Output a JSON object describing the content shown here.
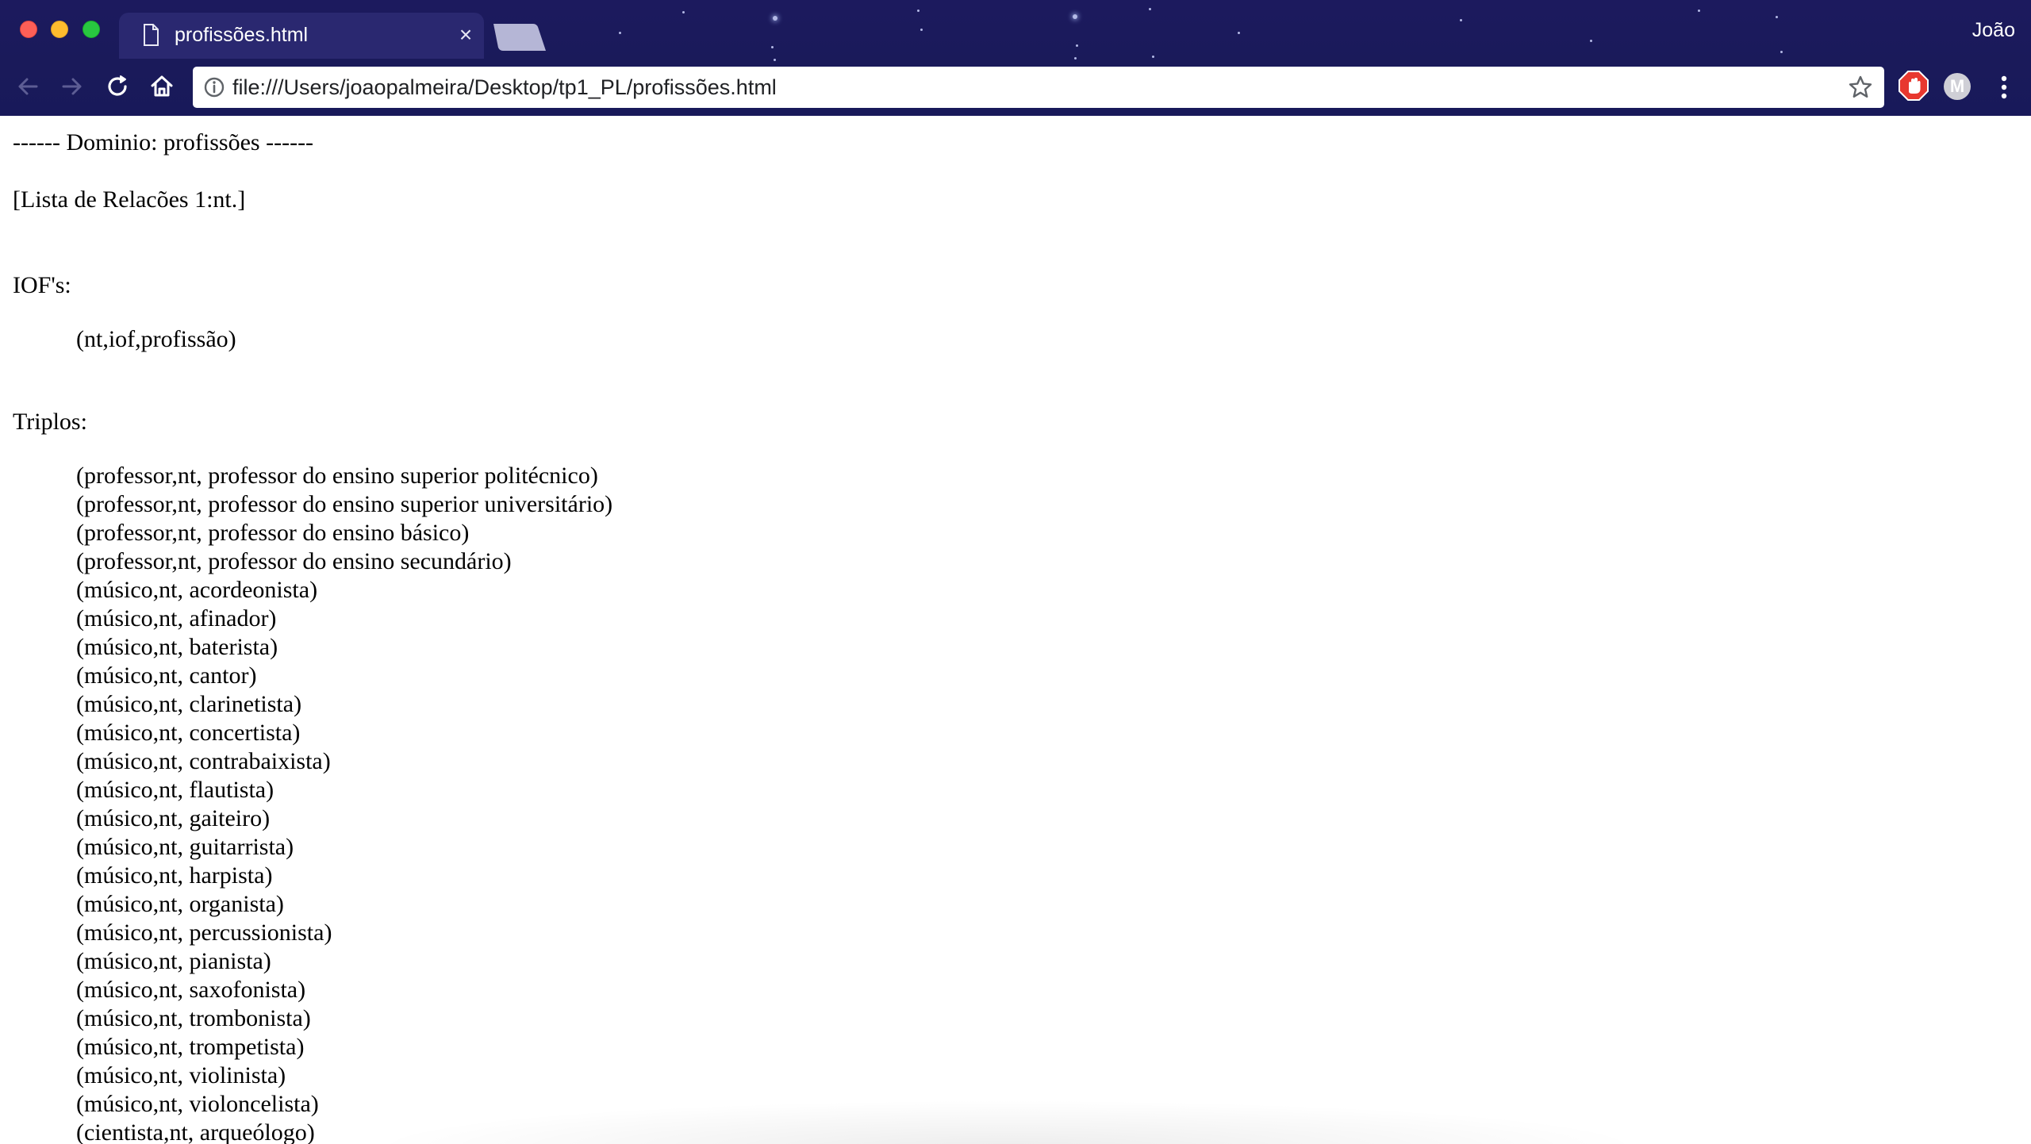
{
  "browser": {
    "tab_title": "profissões.html",
    "tab_close": "×",
    "profile_name": "João",
    "url": "file:///Users/joaopalmeira/Desktop/tp1_PL/profissões.html",
    "extension_m_label": "M"
  },
  "page": {
    "domain_heading": "------ Dominio: profissões ------",
    "relations_heading": "[Lista de Relacões 1:nt.]",
    "iofs_label": "IOF's:",
    "iof_entry": "(nt,iof,profissão)",
    "triples_label": "Triplos:",
    "triples": [
      "(professor,nt, professor do ensino superior politécnico)",
      "(professor,nt, professor do ensino superior universitário)",
      "(professor,nt, professor do ensino básico)",
      "(professor,nt, professor do ensino secundário)",
      "(músico,nt, acordeonista)",
      "(músico,nt, afinador)",
      "(músico,nt, baterista)",
      "(músico,nt, cantor)",
      "(músico,nt, clarinetista)",
      "(músico,nt, concertista)",
      "(músico,nt, contrabaixista)",
      "(músico,nt, flautista)",
      "(músico,nt, gaiteiro)",
      "(músico,nt, guitarrista)",
      "(músico,nt, harpista)",
      "(músico,nt, organista)",
      "(músico,nt, percussionista)",
      "(músico,nt, pianista)",
      "(músico,nt, saxofonista)",
      "(músico,nt, trombonista)",
      "(músico,nt, trompetista)",
      "(músico,nt, violinista)",
      "(músico,nt, violoncelista)",
      "(cientista,nt, arqueólogo)"
    ]
  },
  "icons": {
    "back": "arrow-left-icon",
    "forward": "arrow-right-icon",
    "reload": "reload-icon",
    "home": "home-icon",
    "info": "info-icon",
    "bookmark": "star-icon",
    "menu": "kebab-menu-icon",
    "tab_document": "document-icon"
  },
  "colors": {
    "chrome_background": "#1c1a5e",
    "page_background": "#ffffff",
    "text": "#000000"
  }
}
